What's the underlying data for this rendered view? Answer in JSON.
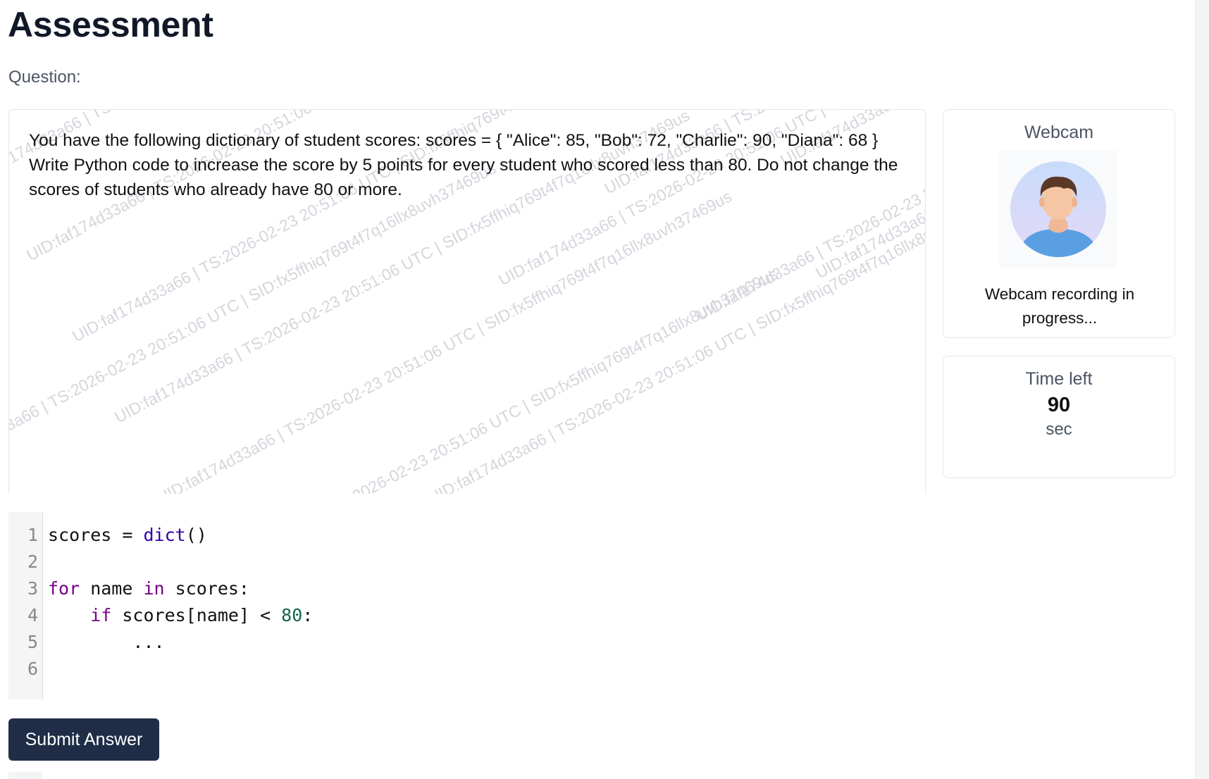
{
  "page": {
    "title": "Assessment"
  },
  "question": {
    "label": "Question:",
    "text": "You have the following dictionary of student scores: scores = { \"Alice\": 85, \"Bob\": 72, \"Charlie\": 90, \"Diana\": 68 } Write Python code to increase the score by 5 points for every student who scored less than 80. Do not change the scores of students who already have 80 or more.",
    "watermark": "UID:faf174d33a66 | TS:2026-02-23 20:51:06 UTC | SID:fx5ffhiq769t4f7q16llx8uvh37469us"
  },
  "webcam": {
    "title": "Webcam",
    "avatar_icon": "user-avatar-icon",
    "status": "Webcam recording in progress..."
  },
  "timer": {
    "title": "Time left",
    "value": "90",
    "unit": "sec"
  },
  "editor": {
    "lines": [
      {
        "number": "1",
        "tokens": [
          {
            "t": "scores = ",
            "c": ""
          },
          {
            "t": "dict",
            "c": "builtin"
          },
          {
            "t": "()",
            "c": ""
          }
        ]
      },
      {
        "number": "2",
        "tokens": []
      },
      {
        "number": "3",
        "tokens": [
          {
            "t": "for",
            "c": "kw"
          },
          {
            "t": " name ",
            "c": ""
          },
          {
            "t": "in",
            "c": "kw"
          },
          {
            "t": " scores:",
            "c": ""
          }
        ]
      },
      {
        "number": "4",
        "tokens": [
          {
            "t": "    ",
            "c": ""
          },
          {
            "t": "if",
            "c": "kw"
          },
          {
            "t": " scores[name] < ",
            "c": ""
          },
          {
            "t": "80",
            "c": "num"
          },
          {
            "t": ":",
            "c": ""
          }
        ]
      },
      {
        "number": "5",
        "tokens": [
          {
            "t": "        ...",
            "c": ""
          }
        ]
      },
      {
        "number": "6",
        "tokens": []
      }
    ]
  },
  "actions": {
    "submit_label": "Submit Answer"
  },
  "colors": {
    "submit_bg": "#1f2d47",
    "keyword": "#770088",
    "builtin": "#3300aa",
    "number": "#116644"
  }
}
